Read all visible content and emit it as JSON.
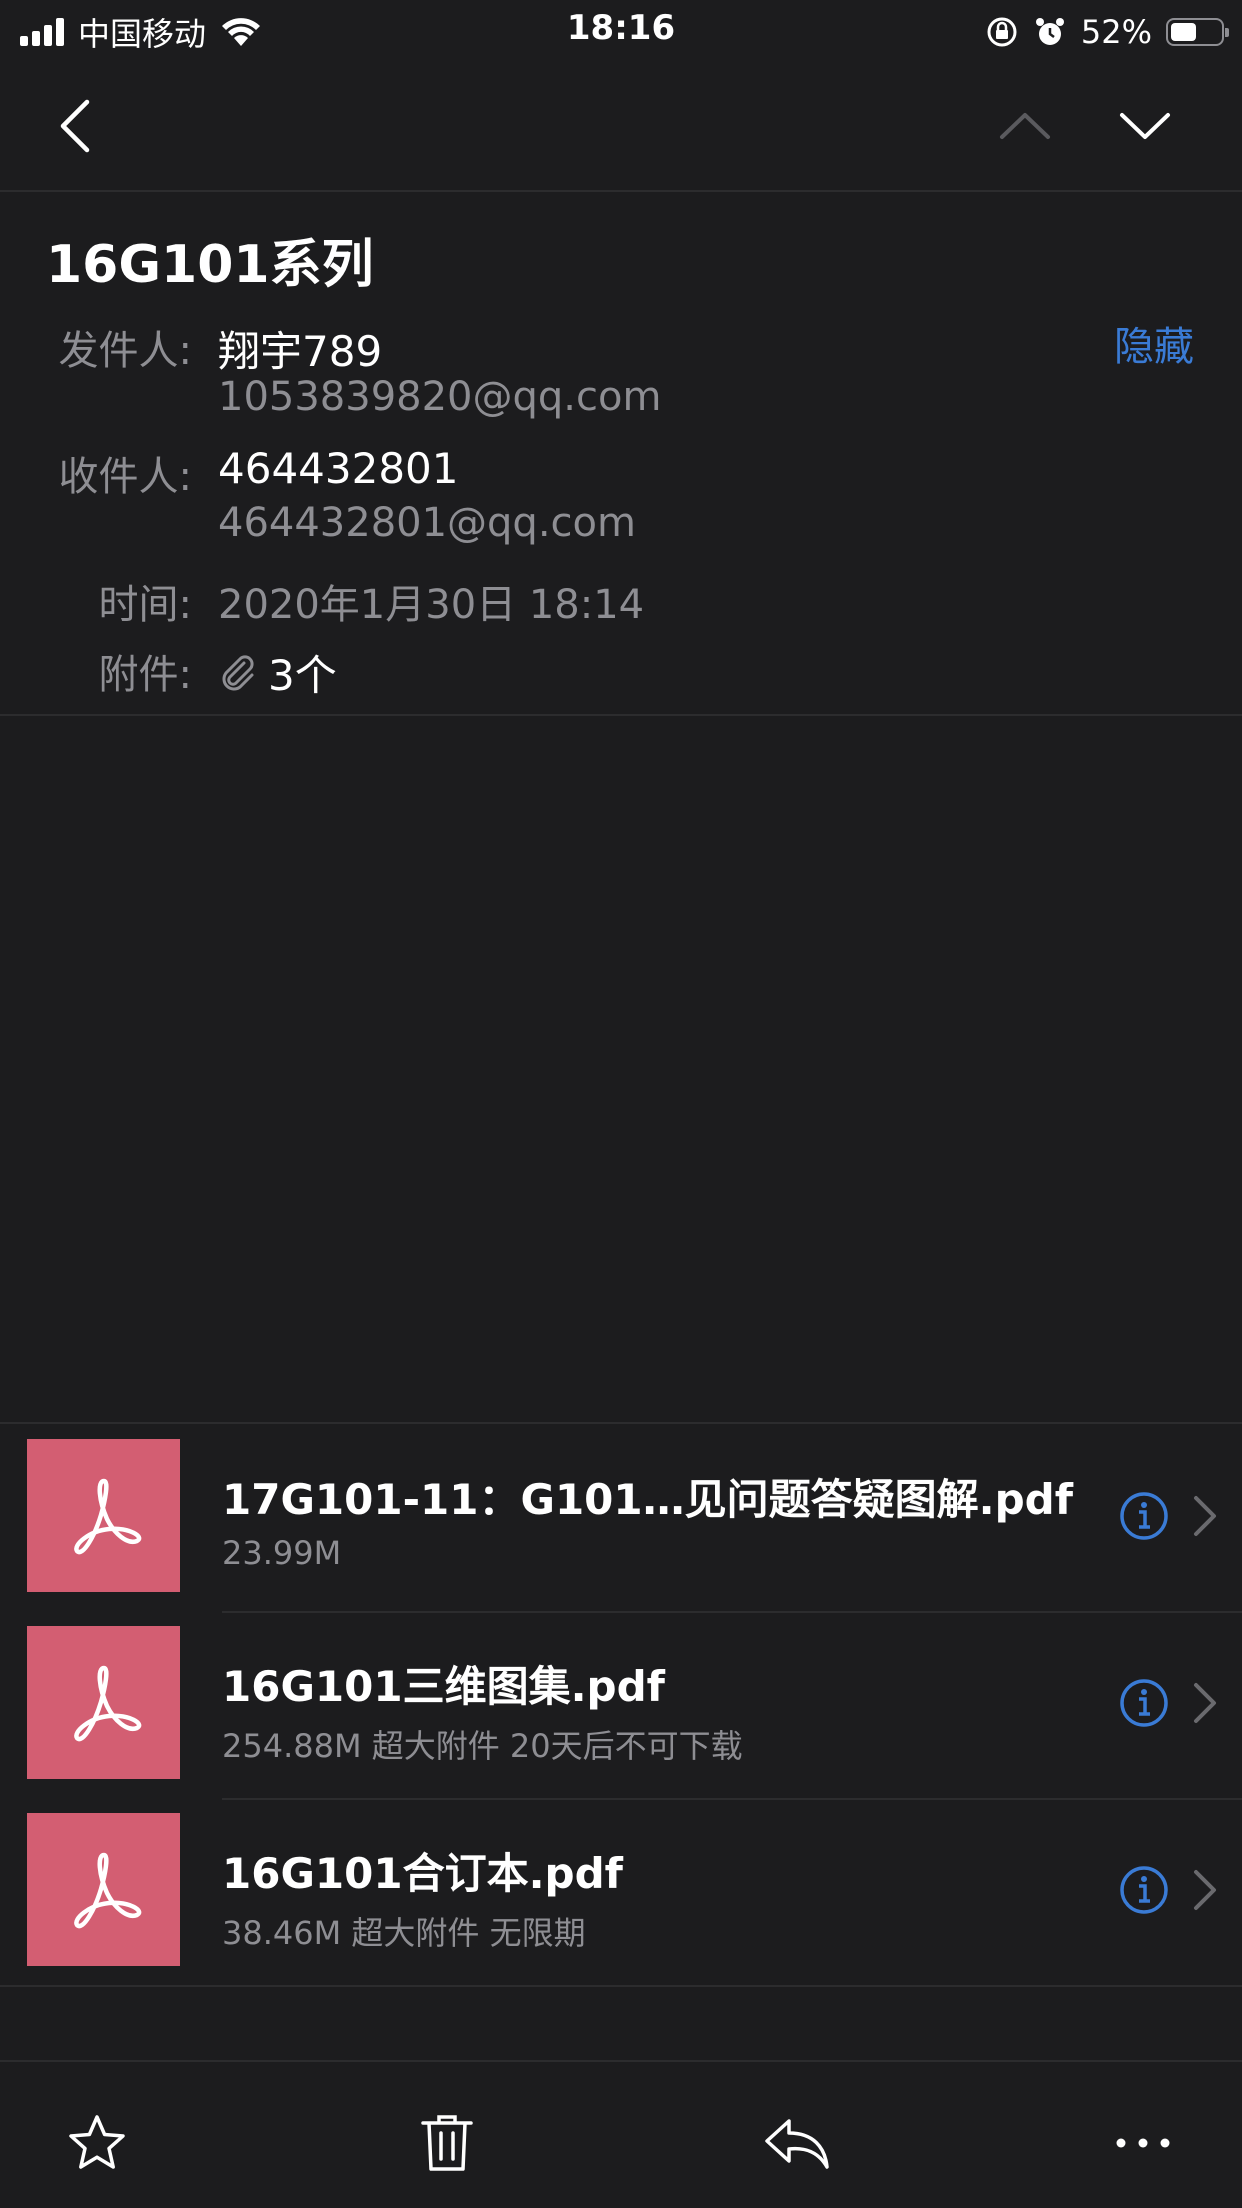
{
  "status_bar": {
    "carrier": "中国移动",
    "time": "18:16",
    "battery_percent": "52%",
    "battery_level": 0.52
  },
  "nav": {
    "back_icon": "chevron-left-icon",
    "prev_icon": "chevron-up-icon",
    "next_icon": "chevron-down-icon"
  },
  "email": {
    "subject": "16G101系列",
    "hide_label": "隐藏",
    "sender_label": "发件人:",
    "sender_name": "翔宇789",
    "sender_email": "1053839820@qq.com",
    "recipient_label": "收件人:",
    "recipient_name": "464432801",
    "recipient_email": "464432801@qq.com",
    "time_label": "时间:",
    "time_value": "2020年1月30日 18:14",
    "attachments_label": "附件:",
    "attachments_count": "3个"
  },
  "attachments": [
    {
      "name": "17G101-11：G101…见问题答疑图解.pdf",
      "info": "23.99M"
    },
    {
      "name": "16G101三维图集.pdf",
      "info": "254.88M 超大附件 20天后不可下载"
    },
    {
      "name": "16G101合订本.pdf",
      "info": "38.46M 超大附件 无限期"
    }
  ],
  "toolbar": {
    "star_icon": "star-icon",
    "delete_icon": "trash-icon",
    "reply_icon": "reply-icon",
    "more_icon": "more-icon"
  },
  "colors": {
    "background": "#1c1c1e",
    "accent": "#3a7bd5",
    "pdf_thumb": "#d35e72",
    "secondary_text": "#8e8e93"
  }
}
